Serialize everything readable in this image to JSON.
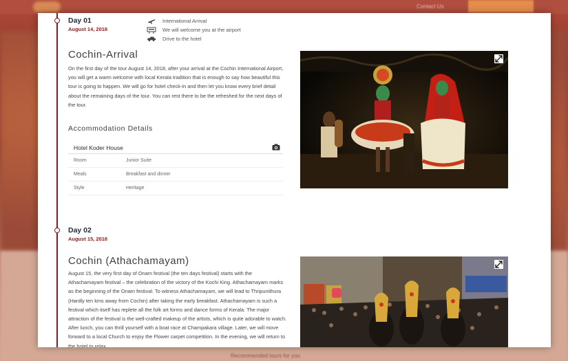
{
  "backdrop": {
    "nav_link": "Contact Us",
    "footer_text": "Recommended tours for you"
  },
  "days": [
    {
      "label": "Day 01",
      "date": "August 14, 2018",
      "itinerary": [
        {
          "icon": "airplane-icon",
          "text": "International Arrival"
        },
        {
          "icon": "welcome-sign-icon",
          "text": "We will welcome you at the airport"
        },
        {
          "icon": "car-icon",
          "text": "Drive to the hotel"
        }
      ],
      "title": "Cochin-Arrival",
      "description": "On the first day of the tour August 14, 2018, after your arrival at the Cochin International Airport, you will get a warm welcome with local Kerala tradition that is enough to say how beautiful this tour is going to happen. We will go for hotel check-in and then let you know every brief detail about the remaining days of the tour. You can rest there to be the refreshed for the next days of the tour.",
      "accommodation": {
        "heading": "Accommodation Details",
        "hotel": "Hotel Koder House",
        "rows": [
          {
            "key": "Room",
            "value": "Junior Suite"
          },
          {
            "key": "Meals",
            "value": "Breakfast and dinner"
          },
          {
            "key": "Style",
            "value": "Heritage"
          }
        ]
      }
    },
    {
      "label": "Day 02",
      "date": "August 15, 2018",
      "title": "Cochin (Athachamayam)",
      "description": "August 15, the very first day of Onam festival (the ten days festival) starts with the Athachamayam festival – the celebration of the victory of the Kochi King. Athachamayam marks as the beginning of the Onam festival. To witness Athachamayam, we will lead to Thripunithura (Hardly ten kms away from Cochin) after taking the early breakfast. Athachamayam is such a festival which itself has replete all the folk art forms and dance forms of Kerala. The major attraction of the festival is the well-crafted makeup of the artists, which is quite adorable to watch. After lunch, you can thrill yourself with a boat race at Champakara village. Later, we will move forward to a local Church to enjoy the Flower carpet competition. In the evening, we will return to the hotel to relax."
    }
  ]
}
